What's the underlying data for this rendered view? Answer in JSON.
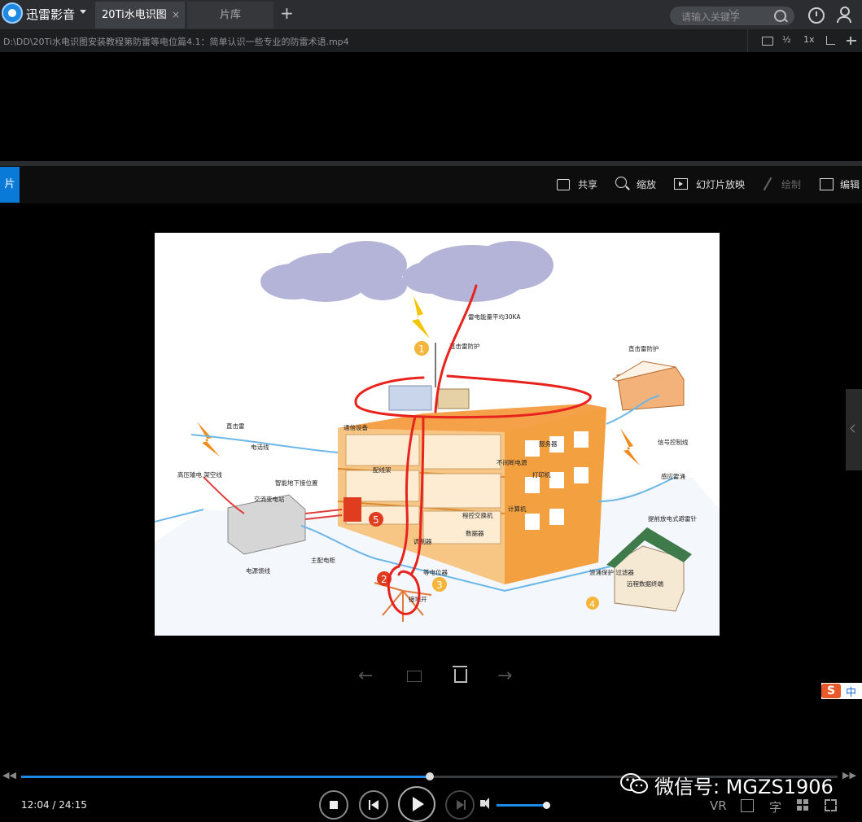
{
  "app": {
    "brand": "迅雷影音"
  },
  "tabs": [
    {
      "label": "20Ti水电识图",
      "close": "×"
    },
    {
      "label": "片库"
    }
  ],
  "tab_add": "+",
  "search": {
    "placeholder": "请输入关键字"
  },
  "file_path": "D:\\DD\\20Ti水电识图安装教程第防雷等电位篇4.1：简单认识一些专业的防雷术语.mp4",
  "path_controls": {
    "half": "½",
    "speed": "1x"
  },
  "viewer": {
    "side_tab": "片",
    "toolbar": {
      "share": "共享",
      "zoom": "缩放",
      "slideshow": "幻灯片放映",
      "draw": "绘制",
      "edit": "编辑"
    }
  },
  "figure_labels": {
    "lightning_energy": "雷电能量平均30KA",
    "direct_protection": "直击雷防护",
    "direct_protection_2": "直击雷防护",
    "direct_lightning": "直击雷",
    "phone_line": "电话线",
    "hv_overhead": "高压输电 架空线",
    "substation": "交流变电站",
    "main_cable": "主配电柜",
    "power_cable": "电源馈线",
    "smart_ground": "智能地下接位置",
    "comm_equipment": "通信设备",
    "distribution": "配线架",
    "ups": "不间断电源",
    "server": "服务器",
    "printer": "打印机",
    "exchange": "程控交换机",
    "computer": "计算机",
    "modem": "调制器",
    "network": "数据器",
    "equipotential": "等电位器",
    "ground_switch": "接地开",
    "signal_control": "信号控制线",
    "sensor": "感应雷涌",
    "lightning_rod": "提前放电式避雷针",
    "remote": "远程数据终端",
    "surge": "浪涌保护 过滤器",
    "num1": "1",
    "num2": "2",
    "num3": "3",
    "num4": "4",
    "num5": "5"
  },
  "playback": {
    "time": "12:04 / 24:15",
    "progress": 0.5,
    "volume": 0.95,
    "rewind": "◀◀",
    "forward": "▶▶"
  },
  "right_controls": {
    "vr": "VR",
    "subtitle": "字"
  },
  "ime": {
    "logo": "S",
    "lang": "中"
  },
  "watermark": "微信号: MGZS1906",
  "colors": {
    "accent": "#1e88e5",
    "annotation": "#e8231d"
  }
}
